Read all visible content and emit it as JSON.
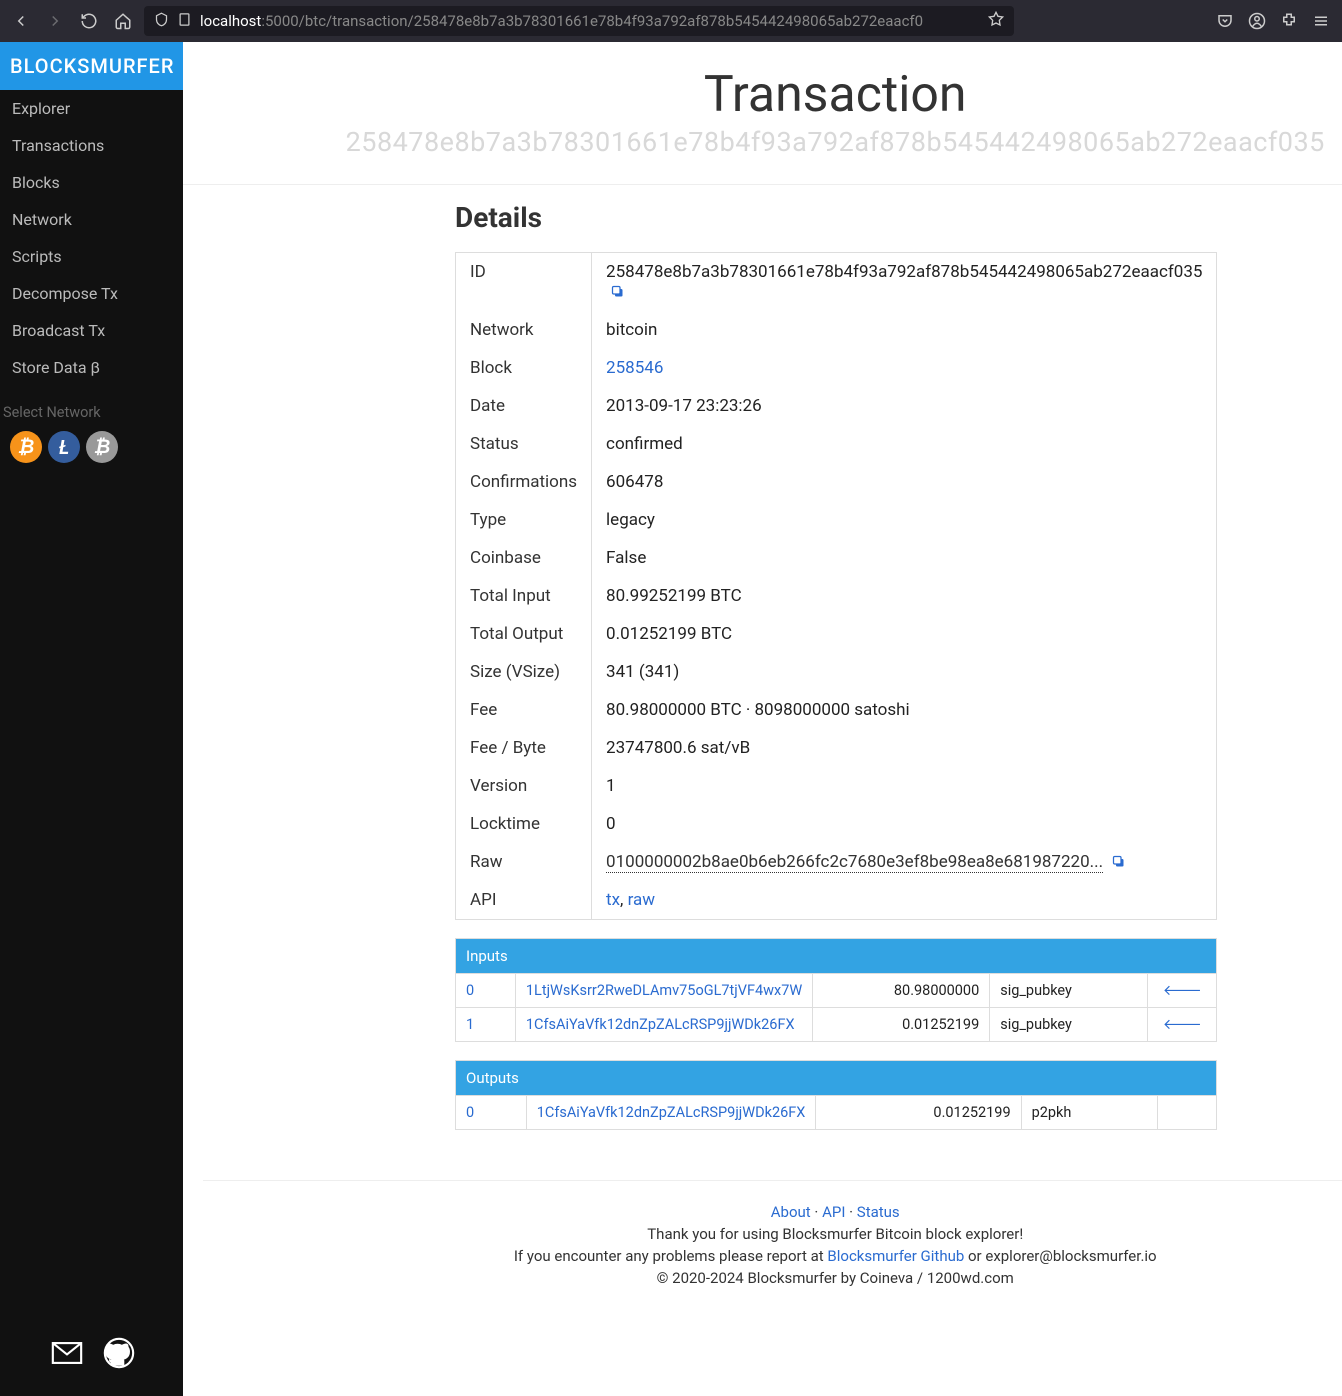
{
  "browser": {
    "url_prefix": ":5000/btc/transaction/258478e8b7a3b78301661e78b4f93a792af878b545442498065ab272eaacf0",
    "host": "localhost"
  },
  "sidebar": {
    "brand": "BLOCKSMURFER",
    "items": [
      "Explorer",
      "Transactions",
      "Blocks",
      "Network",
      "Scripts",
      "Decompose Tx",
      "Broadcast Tx",
      "Store Data β"
    ],
    "select_network": "Select Network"
  },
  "page": {
    "title": "Transaction",
    "hash": "258478e8b7a3b78301661e78b4f93a792af878b545442498065ab272eaacf035",
    "details_heading": "Details"
  },
  "details": {
    "ID": "258478e8b7a3b78301661e78b4f93a792af878b545442498065ab272eaacf035",
    "Network": "bitcoin",
    "Block": "258546",
    "Date": "2013-09-17 23:23:26",
    "Status": "confirmed",
    "Confirmations": "606478",
    "Type": "legacy",
    "Coinbase": "False",
    "Total_Input": "80.99252199 BTC",
    "Total_Output": "0.01252199 BTC",
    "Size_VSize": "341 (341)",
    "Fee": "80.98000000 BTC · 8098000000 satoshi",
    "Fee_Byte": "23747800.6 sat/vB",
    "Version": "1",
    "Locktime": "0",
    "Raw": "0100000002b8ae0b6eb266fc2c7680e3ef8be98ea8e681987220...",
    "API_tx": "tx",
    "API_raw": "raw"
  },
  "detail_labels": {
    "ID": "ID",
    "Network": "Network",
    "Block": "Block",
    "Date": "Date",
    "Status": "Status",
    "Confirmations": "Confirmations",
    "Type": "Type",
    "Coinbase": "Coinbase",
    "Total_Input": "Total Input",
    "Total_Output": "Total Output",
    "Size_VSize": "Size (VSize)",
    "Fee": "Fee",
    "Fee_Byte": "Fee / Byte",
    "Version": "Version",
    "Locktime": "Locktime",
    "Raw": "Raw",
    "API": "API"
  },
  "inputs": {
    "header": "Inputs",
    "rows": [
      {
        "n": "0",
        "addr": "1LtjWsKsrr2RweDLAmv75oGL7tjVF4wx7W",
        "amount": "80.98000000",
        "script": "sig_pubkey"
      },
      {
        "n": "1",
        "addr": "1CfsAiYaVfk12dnZpZALcRSP9jjWDk26FX",
        "amount": "0.01252199",
        "script": "sig_pubkey"
      }
    ]
  },
  "outputs": {
    "header": "Outputs",
    "rows": [
      {
        "n": "0",
        "addr": "1CfsAiYaVfk12dnZpZALcRSP9jjWDk26FX",
        "amount": "0.01252199",
        "script": "p2pkh"
      }
    ]
  },
  "footer": {
    "about": "About",
    "api": "API",
    "status": "Status",
    "thanks": "Thank you for using Blocksmurfer Bitcoin block explorer!",
    "problems_pre": "If you encounter any problems please report at ",
    "github": "Blocksmurfer Github",
    "problems_post": " or explorer@blocksmurfer.io",
    "copyright": "© 2020-2024 Blocksmurfer by Coineva / 1200wd.com"
  }
}
